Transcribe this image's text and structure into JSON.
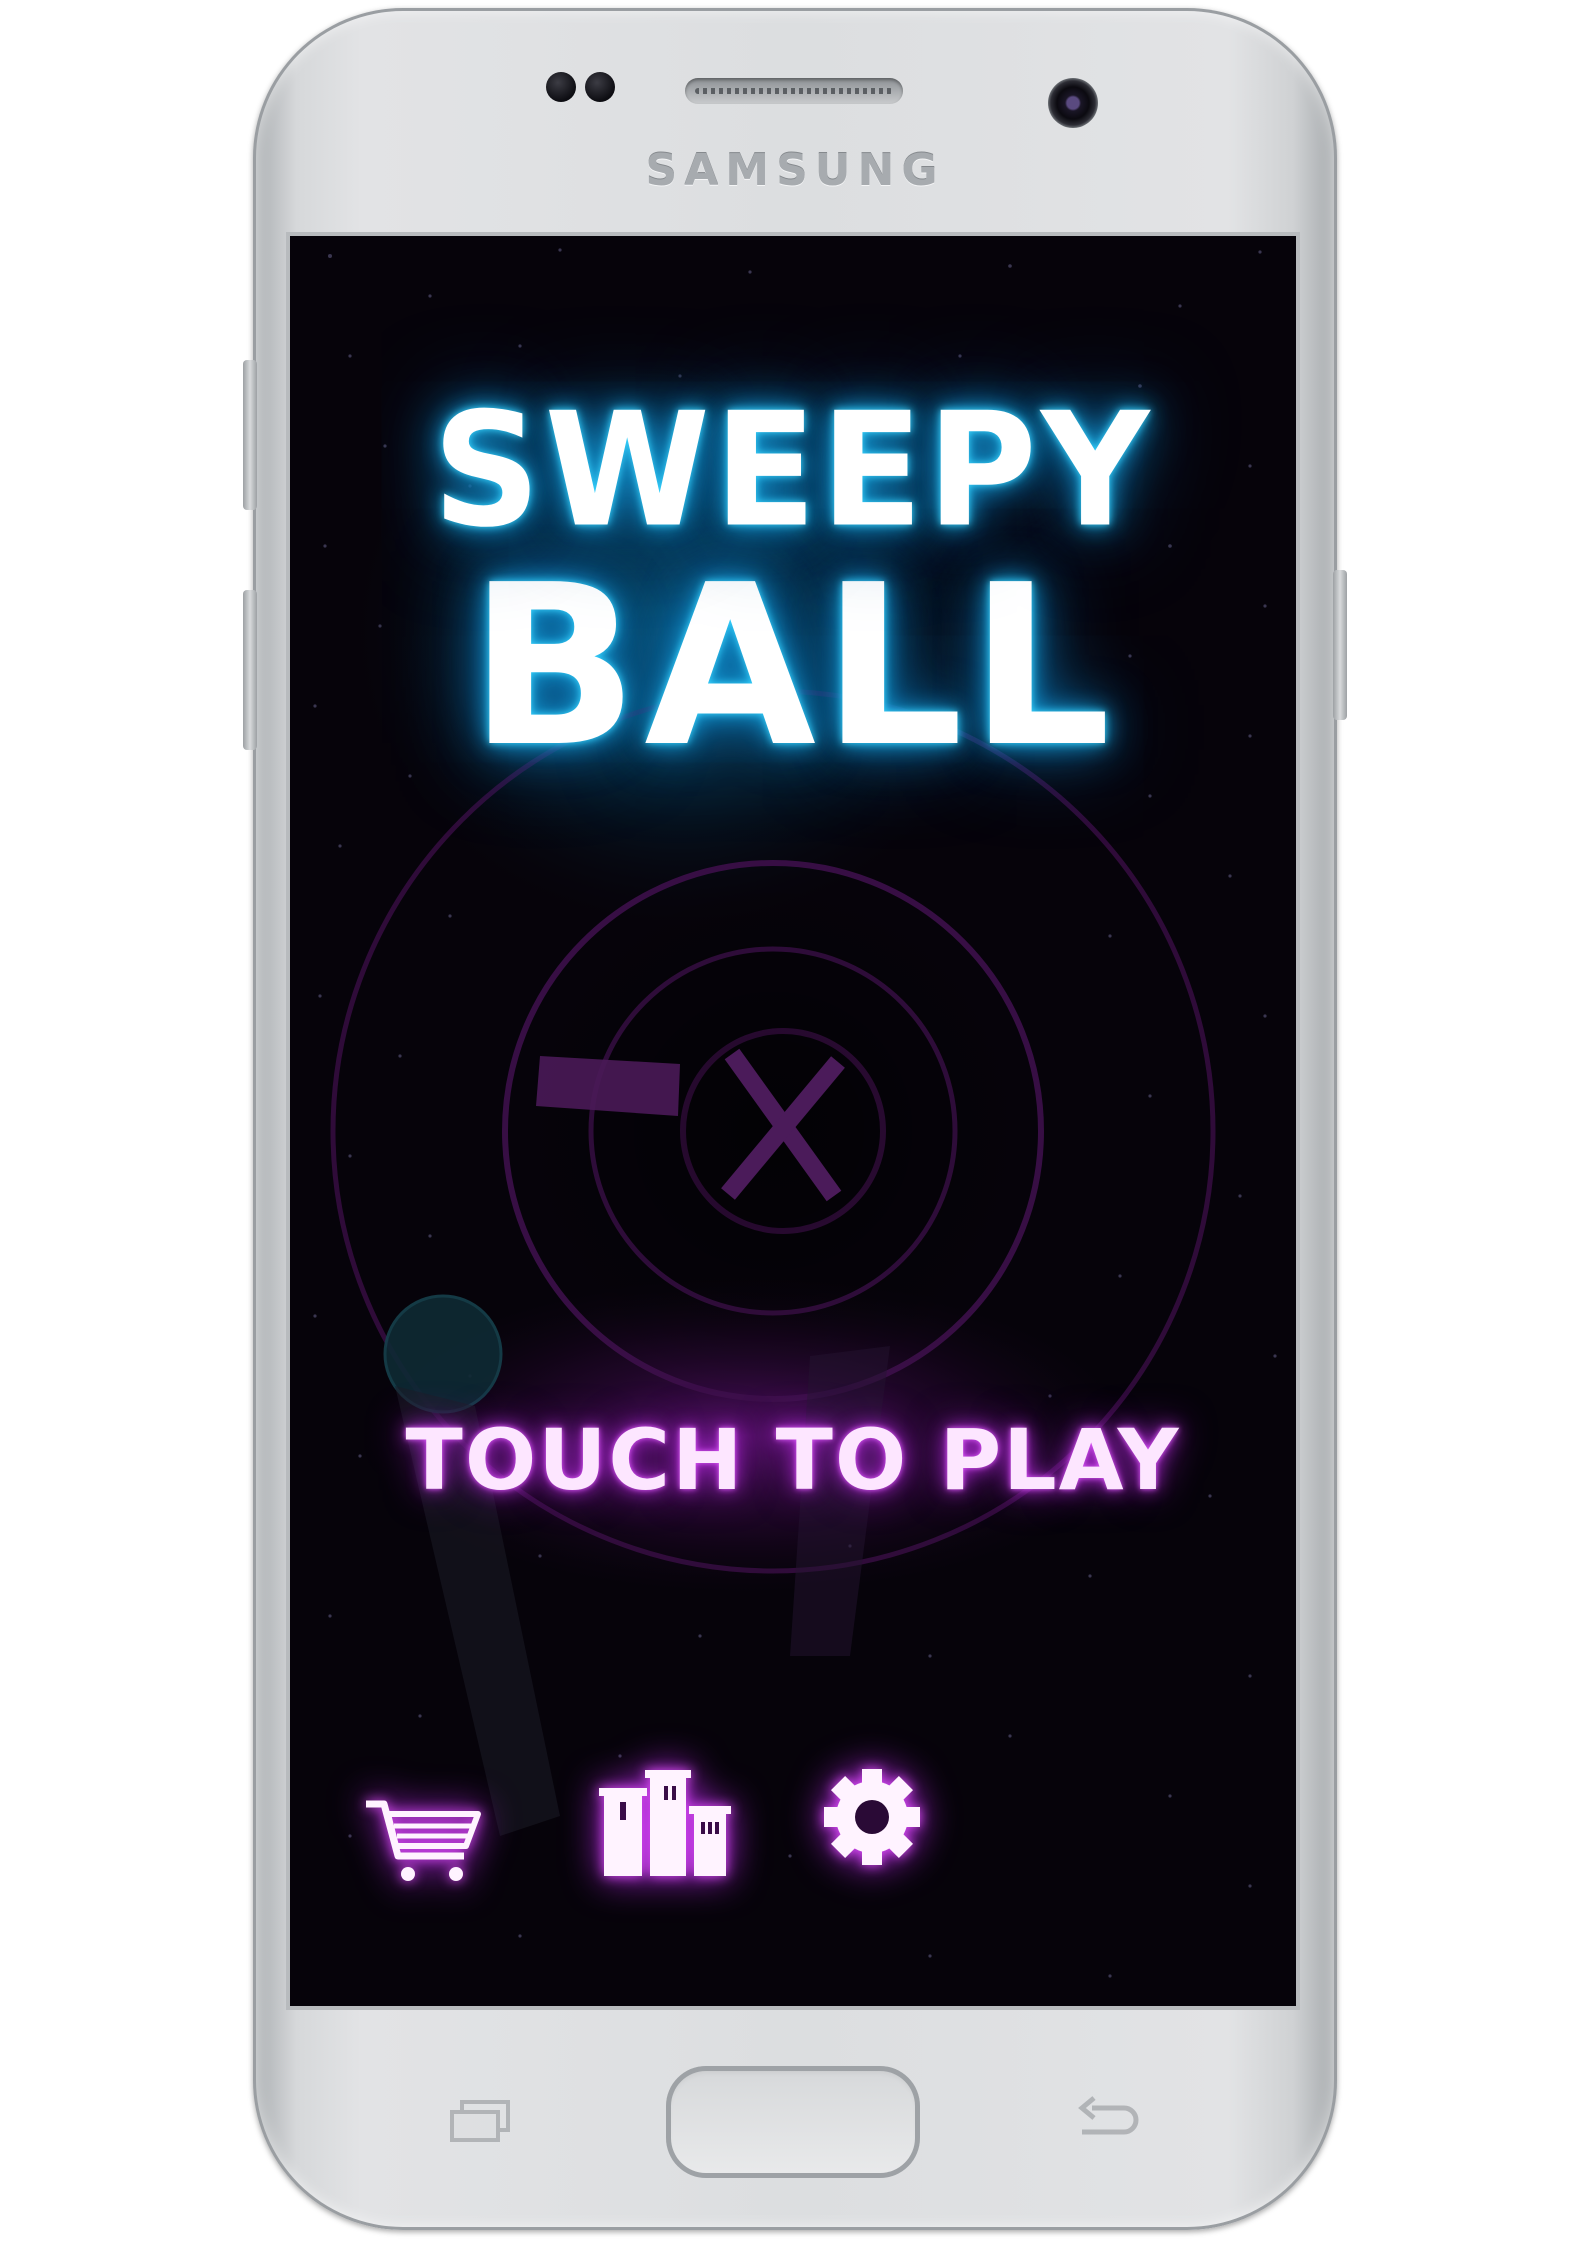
{
  "device": {
    "brand": "SAMSUNG"
  },
  "game": {
    "title_line1": "SWEEPY",
    "title_line2": "BALL",
    "touch_prompt": "TOUCH TO PLAY"
  },
  "menu": {
    "shop_icon": "shopping-cart-icon",
    "leaderboard_icon": "podium-icon",
    "settings_icon": "gear-icon"
  },
  "colors": {
    "title_glow": "#1aa6e0",
    "menu_glow": "#b02ad6",
    "ring": "#4a1358",
    "background": "#06030a"
  },
  "nav": {
    "recent_icon": "recent-apps-icon",
    "home_icon": "home-button",
    "back_icon": "back-icon"
  }
}
